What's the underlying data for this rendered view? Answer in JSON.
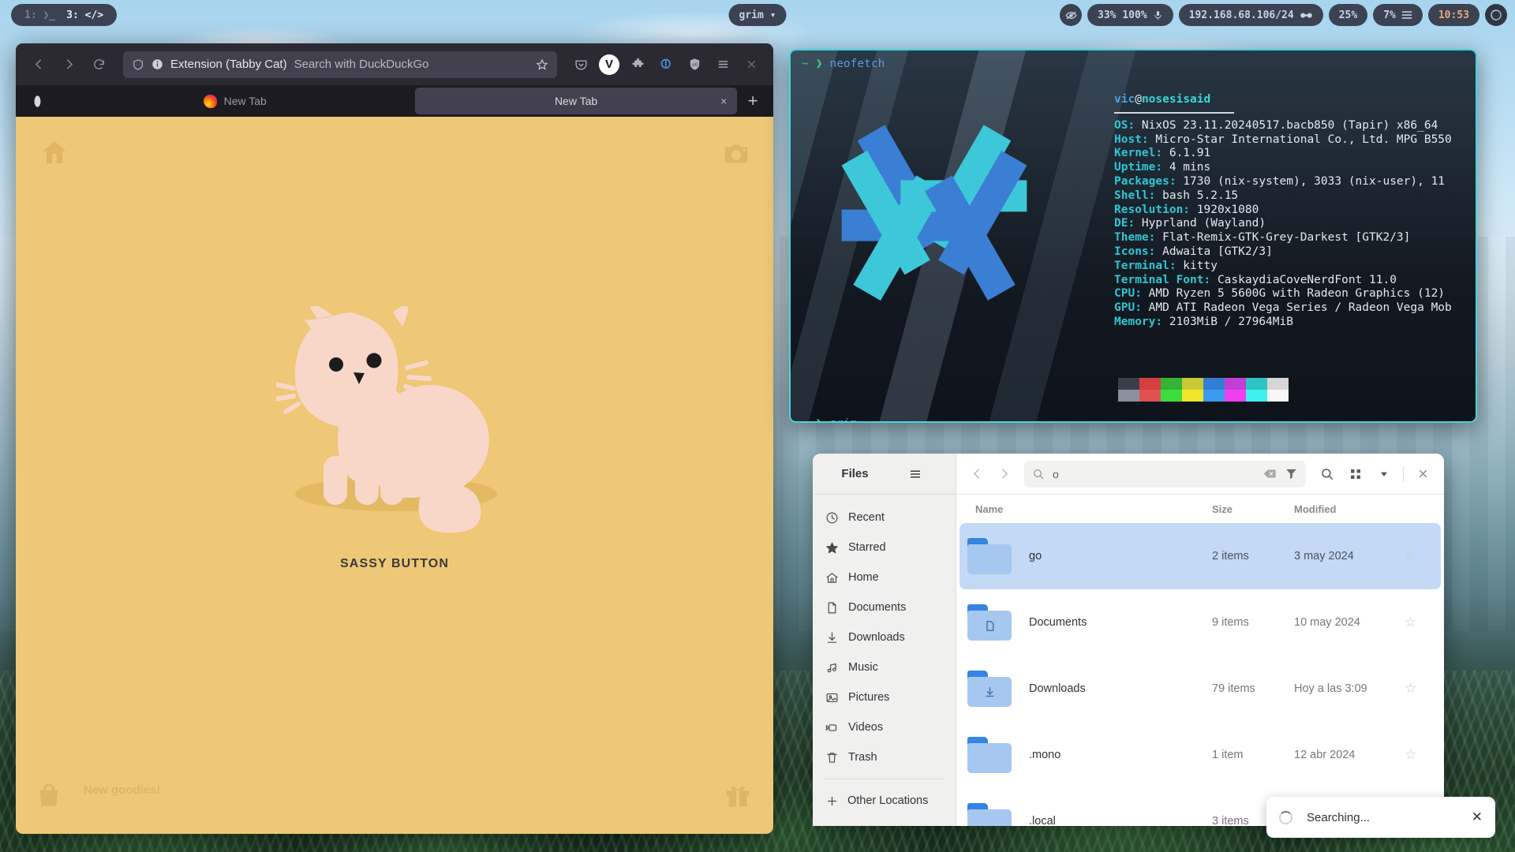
{
  "bar": {
    "workspaces": [
      {
        "id": "1:",
        "glyph": "",
        "active": false
      },
      {
        "id": "3:",
        "glyph": "‹/›",
        "active": true
      }
    ],
    "window_title": "grim ▾",
    "modules": {
      "screencast": "👁",
      "audio": "33%  100%",
      "network": "192.168.68.106/24",
      "cpu": "25%",
      "memory": "7%",
      "clock": "10:53"
    }
  },
  "firefox": {
    "urlbar": {
      "extension_label": "Extension (Tabby Cat)",
      "placeholder_hint": "Search with DuckDuckGo"
    },
    "tabs": [
      {
        "label": "New Tab",
        "active": false
      },
      {
        "label": "New Tab",
        "active": true
      }
    ],
    "newtab_label": "+",
    "tab_close_label": "×",
    "page": {
      "button_label": "SASSY BUTTON",
      "goodies_label": "New goodies!",
      "background_color": "#eec777",
      "cat_color": "#f9d7c8"
    }
  },
  "terminal": {
    "prompts": [
      {
        "tilde": "~",
        "arrow": "❯",
        "command": "neofetch"
      },
      {
        "tilde": "~",
        "arrow": "❯",
        "command": "grim"
      }
    ],
    "neofetch": {
      "user": "vic",
      "at": "@",
      "host": "nosesisaid",
      "entries": [
        {
          "key": "OS",
          "value": "NixOS 23.11.20240517.bacb850 (Tapir) x86_64"
        },
        {
          "key": "Host",
          "value": "Micro-Star International Co., Ltd. MPG B550"
        },
        {
          "key": "Kernel",
          "value": "6.1.91"
        },
        {
          "key": "Uptime",
          "value": "4 mins"
        },
        {
          "key": "Packages",
          "value": "1730 (nix-system), 3033 (nix-user), 11"
        },
        {
          "key": "Shell",
          "value": "bash 5.2.15"
        },
        {
          "key": "Resolution",
          "value": "1920x1080"
        },
        {
          "key": "DE",
          "value": "Hyprland (Wayland)"
        },
        {
          "key": "Theme",
          "value": "Flat-Remix-GTK-Grey-Darkest [GTK2/3]"
        },
        {
          "key": "Icons",
          "value": "Adwaita [GTK2/3]"
        },
        {
          "key": "Terminal",
          "value": "kitty"
        },
        {
          "key": "Terminal Font",
          "value": "CaskaydiaCoveNerdFont 11.0"
        },
        {
          "key": "CPU",
          "value": "AMD Ryzen 5 5600G with Radeon Graphics (12)"
        },
        {
          "key": "GPU",
          "value": "AMD ATI Radeon Vega Series / Radeon Vega Mob"
        },
        {
          "key": "Memory",
          "value": "2103MiB / 27964MiB"
        }
      ],
      "palette_dark": [
        "#3b4048",
        "#d43f3f",
        "#34b334",
        "#c9c934",
        "#2f7fd4",
        "#c13fd4",
        "#2fc4c4",
        "#d6d6d6"
      ],
      "palette_bright": [
        "#8a909c",
        "#e05252",
        "#3fdc3f",
        "#f2e52a",
        "#3a9bf0",
        "#f03ff0",
        "#3ff0f0",
        "#f7f7f7"
      ]
    }
  },
  "files": {
    "title": "Files",
    "search_value": "o",
    "columns": {
      "name": "Name",
      "size": "Size",
      "modified": "Modified"
    },
    "sidebar": [
      {
        "label": "Recent",
        "icon": "clock-icon"
      },
      {
        "label": "Starred",
        "icon": "star-icon"
      },
      {
        "label": "Home",
        "icon": "home-icon"
      },
      {
        "label": "Documents",
        "icon": "document-icon"
      },
      {
        "label": "Downloads",
        "icon": "download-icon"
      },
      {
        "label": "Music",
        "icon": "music-icon"
      },
      {
        "label": "Pictures",
        "icon": "image-icon"
      },
      {
        "label": "Videos",
        "icon": "video-icon"
      },
      {
        "label": "Trash",
        "icon": "trash-icon"
      }
    ],
    "other_locations": "Other Locations",
    "rows": [
      {
        "name": "go",
        "size": "2 items",
        "modified": "3 may 2024",
        "selected": true,
        "glyph": ""
      },
      {
        "name": "Documents",
        "size": "9 items",
        "modified": "10 may 2024",
        "selected": false,
        "glyph": "doc"
      },
      {
        "name": "Downloads",
        "size": "79 items",
        "modified": "Hoy a las 3:09",
        "selected": false,
        "glyph": "dl"
      },
      {
        "name": ".mono",
        "size": "1 item",
        "modified": "12 abr 2024",
        "selected": false,
        "glyph": ""
      },
      {
        "name": ".local",
        "size": "3 items",
        "modified": "",
        "selected": false,
        "glyph": ""
      }
    ],
    "star_glyph": "☆",
    "toast": {
      "label": "Searching...",
      "close": "✕"
    }
  }
}
